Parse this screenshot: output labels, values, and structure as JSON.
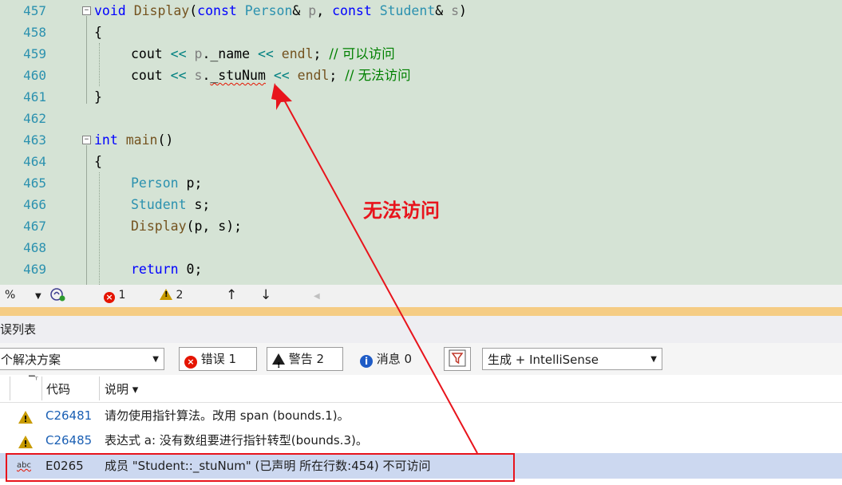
{
  "editor": {
    "lines": [
      {
        "num": "457"
      },
      {
        "num": "458"
      },
      {
        "num": "459"
      },
      {
        "num": "460"
      },
      {
        "num": "461"
      },
      {
        "num": "462"
      },
      {
        "num": "463"
      },
      {
        "num": "464"
      },
      {
        "num": "465"
      },
      {
        "num": "466"
      },
      {
        "num": "467"
      },
      {
        "num": "468"
      },
      {
        "num": "469"
      }
    ],
    "code": {
      "l457": {
        "kw1": "void",
        "fn": "Display",
        "p1": "(",
        "kw2": "const",
        "ty1": "Person",
        "amp1": "& ",
        "pm1": "p",
        "comma": ", ",
        "kw3": "const",
        "ty2": "Student",
        "amp2": "& ",
        "pm2": "s",
        "p2": ")"
      },
      "l458": "{",
      "l459": {
        "obj": "cout",
        "op1": " << ",
        "var": "p",
        "dot": ".",
        "member": "_name",
        "op2": " << ",
        "endl": "endl",
        "semi": "; ",
        "comment": "// 可以访问"
      },
      "l460": {
        "obj": "cout",
        "op1": " << ",
        "var": "s",
        "dot": ".",
        "member": "_stuNum",
        "op2": " << ",
        "endl": "endl",
        "semi": "; ",
        "comment": "// 无法访问"
      },
      "l461": "}",
      "l463": {
        "kw": "int",
        "fn": "main",
        "rest": "()"
      },
      "l464": "{",
      "l465": {
        "ty": "Person",
        "rest": " p;"
      },
      "l466": {
        "ty": "Student",
        "rest": " s;"
      },
      "l467": {
        "fn": "Display",
        "p1": "(",
        "a": "p",
        "c": ", ",
        "b": "s",
        "p2": ");"
      },
      "l469": {
        "kw": "return",
        "rest": " 0;"
      }
    }
  },
  "status": {
    "zoom": "%",
    "error_count": "1",
    "warning_count": "2",
    "up_arrow": "↑",
    "down_arrow": "↓"
  },
  "panel": {
    "title": "误列表",
    "scope_select": "个解决方案",
    "errors_button": "错误 1",
    "warnings_button": "警告 2",
    "messages_button": "消息 0",
    "build_select": "生成 + IntelliSense",
    "columns": {
      "code": "代码",
      "desc": "说明 ▾"
    },
    "rows": [
      {
        "icon": "warning-icon",
        "code": "C26481",
        "desc": "请勿使用指针算法。改用 span (bounds.1)。"
      },
      {
        "icon": "warning-icon",
        "code": "C26485",
        "desc": "表达式 a: 没有数组要进行指针转型(bounds.3)。"
      },
      {
        "icon": "spell-error-icon",
        "code": "E0265",
        "desc": "成员 \"Student::_stuNum\" (已声明 所在行数:454) 不可访问"
      }
    ]
  },
  "annotation": {
    "label": "无法访问"
  },
  "colors": {
    "editor_bg": "#d5e3d5",
    "accent_red": "#e8141c",
    "line_number": "#2b91af",
    "keyword": "#0000ff"
  }
}
